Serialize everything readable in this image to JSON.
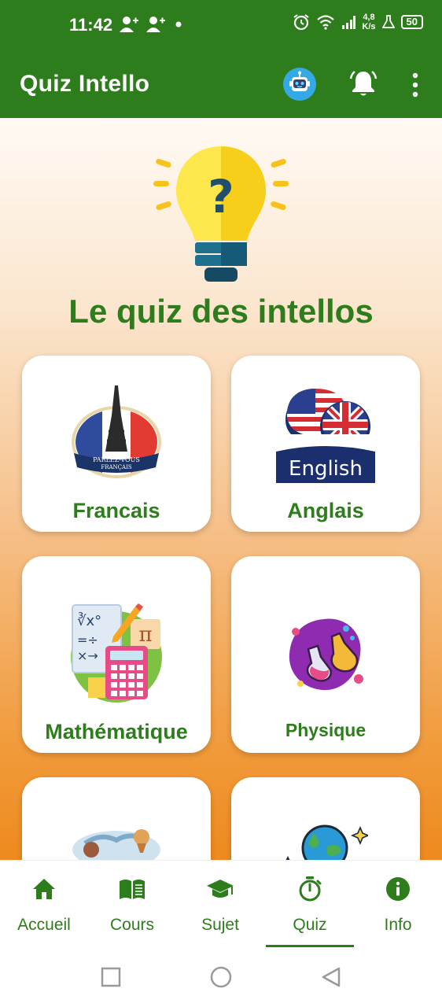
{
  "status_bar": {
    "time": "11:42",
    "net_speed_value": "4,8",
    "net_speed_unit": "K/s",
    "battery": "50"
  },
  "app_bar": {
    "title": "Quiz Intello",
    "icons": [
      "robot-icon",
      "bell-icon",
      "more-vert-icon"
    ]
  },
  "main": {
    "heading": "Le quiz des intellos",
    "cards": [
      {
        "label": "Francais",
        "icon": "eiffel-tower-icon"
      },
      {
        "label": "Anglais",
        "icon": "english-flags-icon",
        "art_text": "English"
      },
      {
        "label": "Mathématique",
        "icon": "math-tools-icon",
        "art_text": "π"
      },
      {
        "label": "Physique",
        "icon": "lab-flask-icon"
      },
      {
        "label": "",
        "icon": "world-travel-icon"
      },
      {
        "label": "",
        "icon": "globe-icon"
      }
    ],
    "eiffel_badge_text_1": "PARLEZ-VOUS",
    "eiffel_badge_text_2": "FRANÇAIS"
  },
  "bottom_nav": {
    "items": [
      {
        "label": "Accueil",
        "icon": "home-icon"
      },
      {
        "label": "Cours",
        "icon": "book-icon"
      },
      {
        "label": "Sujet",
        "icon": "graduation-cap-icon"
      },
      {
        "label": "Quiz",
        "icon": "stopwatch-icon",
        "selected": true
      },
      {
        "label": "Info",
        "icon": "info-icon"
      }
    ]
  },
  "colors": {
    "primary": "#2e7d1c",
    "gradient_top": "#fffaf4",
    "gradient_bottom": "#ee8a1e",
    "card_bg": "#ffffff"
  }
}
